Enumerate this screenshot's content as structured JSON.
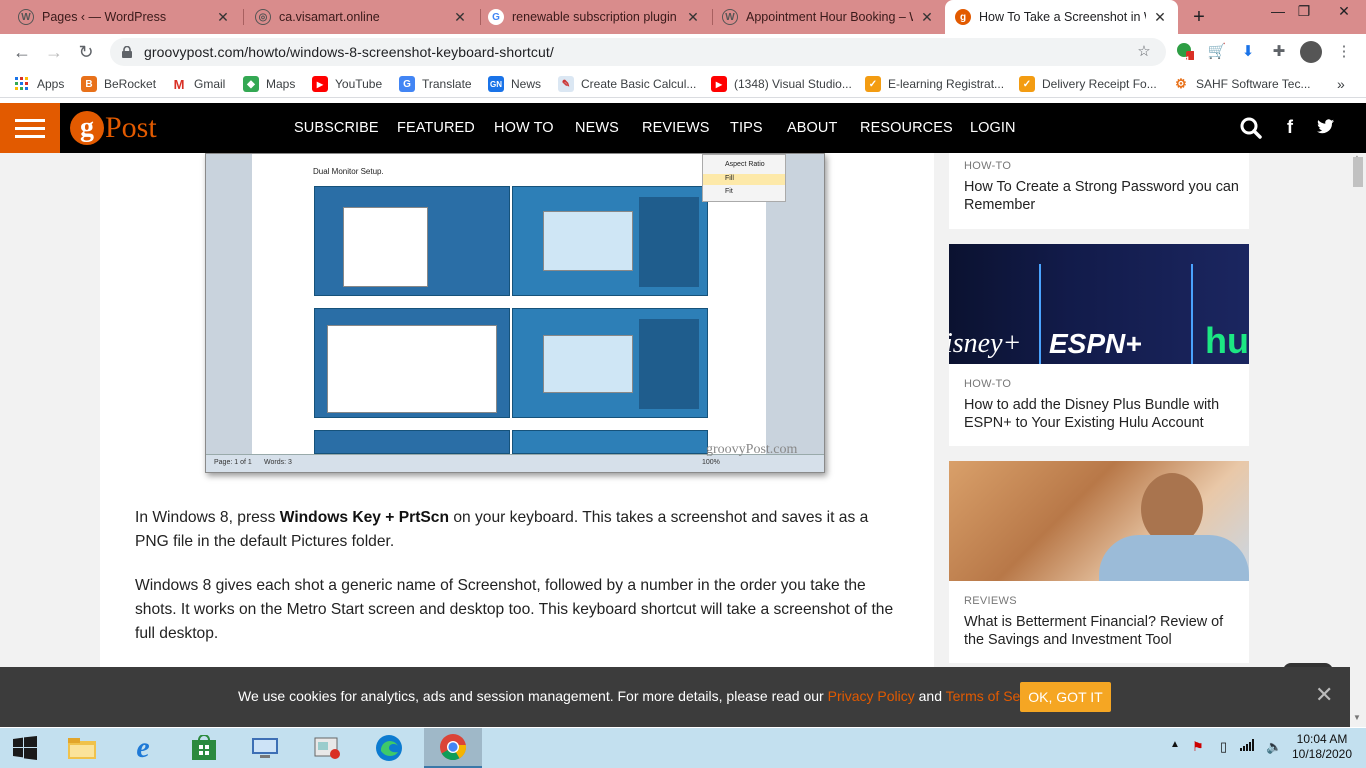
{
  "tabs": [
    {
      "title": "Pages ‹ — WordPress",
      "icon": "wordpress-icon"
    },
    {
      "title": "ca.visamart.online",
      "icon": "globe-icon"
    },
    {
      "title": "renewable subscription plugin fo",
      "icon": "google-icon"
    },
    {
      "title": "Appointment Hour Booking – W",
      "icon": "wordpress-icon"
    },
    {
      "title": "How To Take a Screenshot in W",
      "icon": "groovypost-icon"
    }
  ],
  "address": {
    "url": "groovypost.com/howto/windows-8-screenshot-keyboard-shortcut/"
  },
  "extensions": {
    "badge": "1"
  },
  "bookmarks": [
    {
      "label": "Apps",
      "icon": "apps-grid-icon"
    },
    {
      "label": "BeRocket",
      "icon": "berocket-icon"
    },
    {
      "label": "Gmail",
      "icon": "gmail-icon"
    },
    {
      "label": "Maps",
      "icon": "maps-icon"
    },
    {
      "label": "YouTube",
      "icon": "youtube-icon"
    },
    {
      "label": "Translate",
      "icon": "translate-icon"
    },
    {
      "label": "News",
      "icon": "news-icon"
    },
    {
      "label": "Create Basic Calcul...",
      "icon": "calculator-icon"
    },
    {
      "label": "(1348) Visual Studio...",
      "icon": "youtube-icon"
    },
    {
      "label": "E-learning Registrat...",
      "icon": "bookmark-page-icon"
    },
    {
      "label": "Delivery Receipt Fo...",
      "icon": "bookmark-page-icon"
    },
    {
      "label": "SAHF Software Tec...",
      "icon": "sahf-icon"
    }
  ],
  "site": {
    "logo_letter": "g",
    "logo_text": "Post",
    "nav": [
      "SUBSCRIBE",
      "FEATURED",
      "HOW TO",
      "NEWS",
      "REVIEWS",
      "TIPS",
      "ABOUT",
      "RESOURCES",
      "LOGIN"
    ]
  },
  "article": {
    "screenshot": {
      "doc_title": "Dual Monitor Setup.",
      "menu_items": [
        "Aspect Ratio",
        "Fill",
        "Fit"
      ],
      "status_page": "Page: 1 of 1",
      "status_words": "Words: 3",
      "zoom": "100%",
      "watermark": "groovyPost.com"
    },
    "p1_a": "In Windows 8, press ",
    "p1_bold": "Windows Key + PrtScn",
    "p1_b": " on your keyboard. This takes a screenshot and saves it as a PNG file in the default Pictures folder.",
    "p2": "Windows 8 gives each shot a generic name of Screenshot, followed by a number in the order you take the shots. It works on the Metro Start screen and desktop too. This keyboard shortcut will take a screenshot of the full desktop."
  },
  "sidebar": [
    {
      "category": "HOW-TO",
      "title": "How To Create a Strong Password you can Remember"
    },
    {
      "category": "HOW-TO",
      "title": "How to add the Disney Plus Bundle with ESPN+ to Your Existing Hulu Account",
      "image_text": [
        "isney+",
        "ESPN+",
        "hu"
      ]
    },
    {
      "category": "REVIEWS",
      "title": "What is Betterment Financial? Review of the Savings and Investment Tool"
    }
  ],
  "cookie": {
    "text": "We use cookies for analytics, ads and session management. For more details, please read our ",
    "privacy": "Privacy Policy",
    "and": " and ",
    "terms": "Terms of Service",
    "period": ".",
    "ok": "OK, GOT IT"
  },
  "taskbar": {
    "time": "10:04 AM",
    "date": "10/18/2020"
  },
  "colors": {
    "accent": "#e25a00",
    "tabbar": "#d98c8c",
    "cookie_button": "#f5a623",
    "taskbar": "#c3e0ef"
  }
}
